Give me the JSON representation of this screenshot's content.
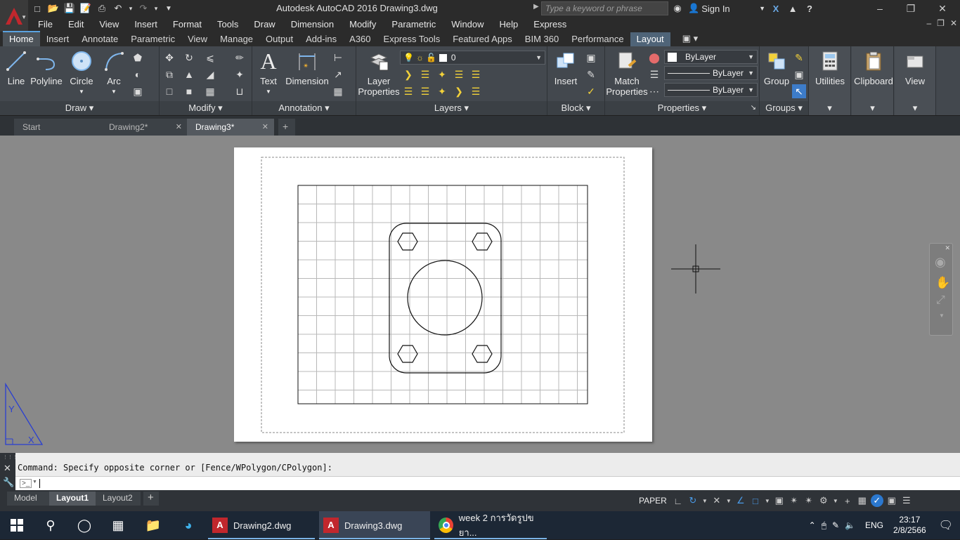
{
  "titlebar": {
    "title": "Autodesk AutoCAD 2016    Drawing3.dwg",
    "search_placeholder": "Type a keyword or phrase",
    "signin_label": "Sign In"
  },
  "menu": [
    "File",
    "Edit",
    "View",
    "Insert",
    "Format",
    "Tools",
    "Draw",
    "Dimension",
    "Modify",
    "Parametric",
    "Window",
    "Help",
    "Express"
  ],
  "ribbon_tabs": [
    "Home",
    "Insert",
    "Annotate",
    "Parametric",
    "View",
    "Manage",
    "Output",
    "Add-ins",
    "A360",
    "Express Tools",
    "Featured Apps",
    "BIM 360",
    "Performance",
    "Layout"
  ],
  "panels": {
    "draw": {
      "title": "Draw",
      "line": "Line",
      "polyline": "Polyline",
      "circle": "Circle",
      "arc": "Arc"
    },
    "modify": {
      "title": "Modify"
    },
    "annotation": {
      "title": "Annotation",
      "text": "Text",
      "dimension": "Dimension"
    },
    "layers": {
      "title": "Layers",
      "layer_properties_1": "Layer",
      "layer_properties_2": "Properties",
      "current_layer": "0"
    },
    "block": {
      "title": "Block",
      "insert": "Insert"
    },
    "properties": {
      "title": "Properties",
      "match_1": "Match",
      "match_2": "Properties",
      "color": "ByLayer",
      "linetype": "ByLayer",
      "lineweight": "ByLayer"
    },
    "groups": {
      "title": "Groups",
      "group": "Group"
    },
    "utilities": {
      "label": "Utilities"
    },
    "clipboard": {
      "label": "Clipboard"
    },
    "view": {
      "label": "View"
    }
  },
  "file_tabs": [
    "Start",
    "Drawing2*",
    "Drawing3*"
  ],
  "command": {
    "history": "Command: Specify opposite corner or [Fence/WPolygon/CPolygon]:",
    "prompt_icon": ">_"
  },
  "layout_tabs": [
    "Model",
    "Layout1",
    "Layout2"
  ],
  "status": {
    "space": "PAPER"
  },
  "taskbar": {
    "apps": [
      "Drawing2.dwg",
      "Drawing3.dwg",
      "week 2 การวัดรูปขยา..."
    ],
    "lang": "ENG",
    "time": "23:17",
    "date": "2/8/2566"
  },
  "colors": {
    "accent": "#5aa2e0",
    "autocad_red": "#c1272d",
    "ribbon_bg": "#43484e",
    "canvas_bg": "#898989"
  }
}
